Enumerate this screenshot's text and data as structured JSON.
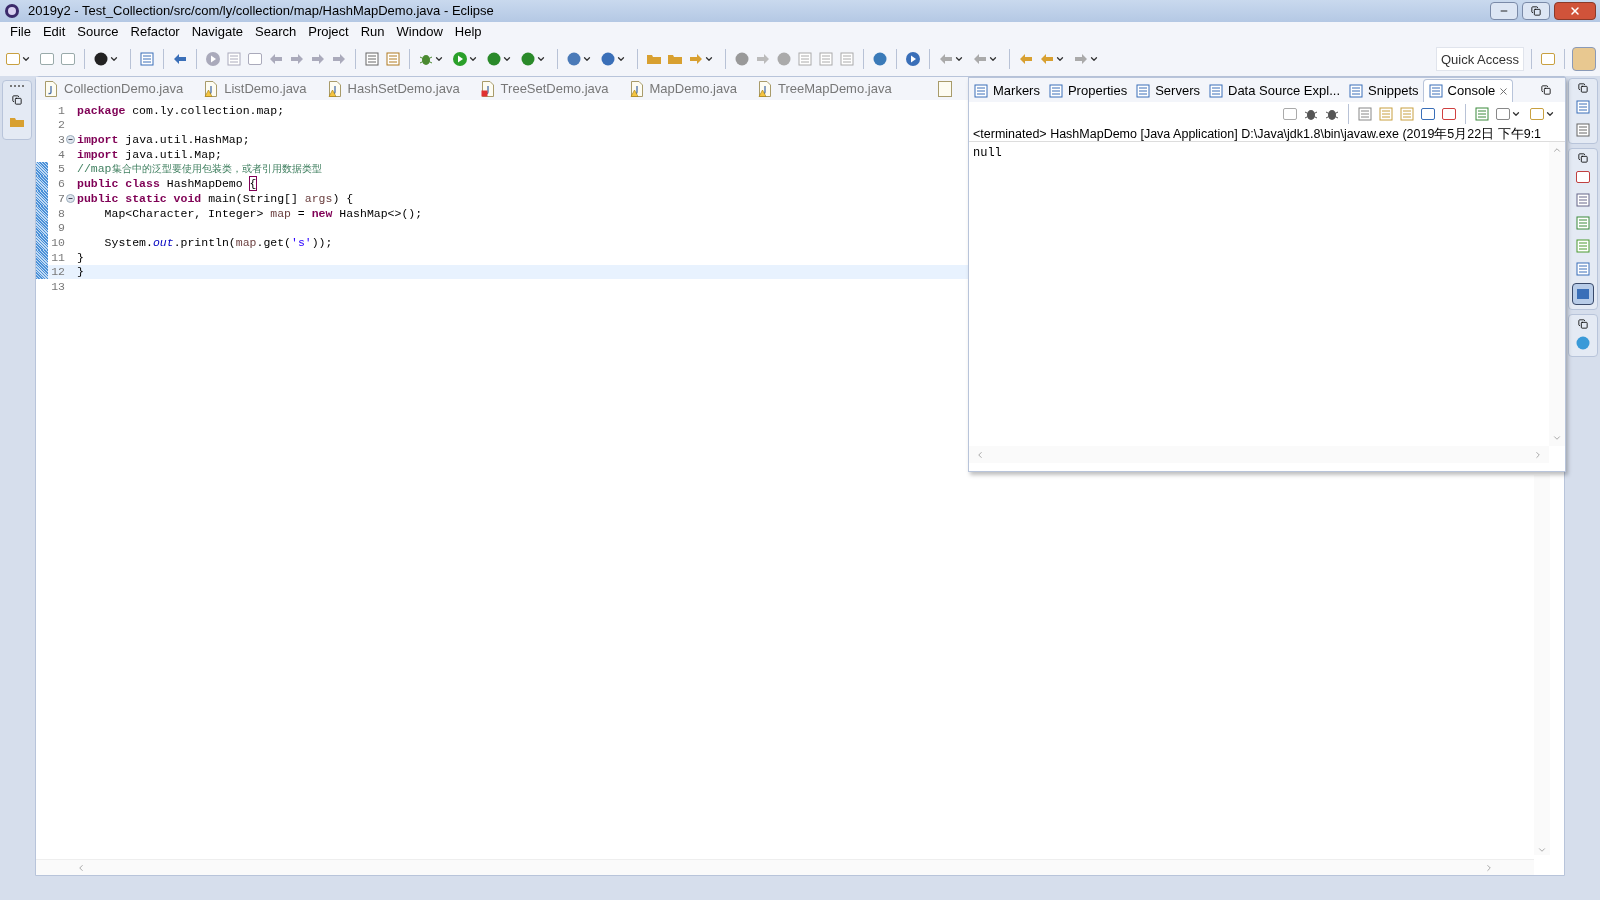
{
  "window": {
    "title": "2019y2 - Test_Collection/src/com/ly/collection/map/HashMapDemo.java - Eclipse"
  },
  "menu": [
    "File",
    "Edit",
    "Source",
    "Refactor",
    "Navigate",
    "Search",
    "Project",
    "Run",
    "Window",
    "Help"
  ],
  "toolbar": {
    "quick_access": {
      "placeholder": "Quick Access"
    }
  },
  "editor": {
    "tabs": [
      {
        "label": "CollectionDemo.java",
        "selected": false,
        "warning": false,
        "error": false
      },
      {
        "label": "ListDemo.java",
        "selected": false,
        "warning": true,
        "error": false
      },
      {
        "label": "HashSetDemo.java",
        "selected": false,
        "warning": true,
        "error": false
      },
      {
        "label": "TreeSetDemo.java",
        "selected": false,
        "warning": false,
        "error": true
      },
      {
        "label": "MapDemo.java",
        "selected": false,
        "warning": true,
        "error": false
      },
      {
        "label": "TreeMapDemo.java",
        "selected": false,
        "warning": true,
        "error": false
      }
    ],
    "lines": [
      {
        "number": "1",
        "fold": false,
        "changed": false,
        "current": false,
        "tokens": [
          {
            "kind": "keyword",
            "text": "package"
          },
          {
            "kind": "plain",
            "text": " com.ly.collection.map;"
          }
        ]
      },
      {
        "number": "2",
        "fold": false,
        "changed": false,
        "current": false
      },
      {
        "number": "3",
        "fold": true,
        "changed": false,
        "current": false,
        "tokens": [
          {
            "kind": "keyword",
            "text": "import"
          },
          {
            "kind": "plain",
            "text": " java.util.HashMap;"
          }
        ]
      },
      {
        "number": "4",
        "fold": false,
        "changed": false,
        "current": false,
        "tokens": [
          {
            "kind": "keyword",
            "text": "import"
          },
          {
            "kind": "plain",
            "text": " java.util.Map;"
          }
        ]
      },
      {
        "number": "5",
        "fold": false,
        "changed": true,
        "current": false,
        "tokens": [
          {
            "kind": "comment",
            "text": "//map"
          },
          {
            "kind": "comment_cjk",
            "text": "集合中的泛型要使用包装类，或者引用数据类型"
          }
        ]
      },
      {
        "number": "6",
        "fold": false,
        "changed": true,
        "current": false,
        "tokens": [
          {
            "kind": "keyword",
            "text": "public class"
          },
          {
            "kind": "plain",
            "text": " HashMapDemo "
          },
          {
            "kind": "bracket_match",
            "text": "{"
          }
        ]
      },
      {
        "number": "7",
        "fold": true,
        "changed": true,
        "current": false,
        "tokens": [
          {
            "kind": "keyword",
            "text": "public static void"
          },
          {
            "kind": "plain",
            "text": " main(String[] "
          },
          {
            "kind": "local",
            "text": "args"
          },
          {
            "kind": "plain",
            "text": ") {"
          }
        ]
      },
      {
        "number": "8",
        "fold": false,
        "changed": true,
        "current": false,
        "tokens": [
          {
            "kind": "plain",
            "text": "    Map<Character, Integer> "
          },
          {
            "kind": "local",
            "text": "map"
          },
          {
            "kind": "plain",
            "text": " = "
          },
          {
            "kind": "keyword",
            "text": "new"
          },
          {
            "kind": "plain",
            "text": " HashMap<>();"
          }
        ]
      },
      {
        "number": "9",
        "fold": false,
        "changed": true,
        "current": false
      },
      {
        "number": "10",
        "fold": false,
        "changed": true,
        "current": false,
        "tokens": [
          {
            "kind": "plain",
            "text": "    System."
          },
          {
            "kind": "field",
            "text": "out"
          },
          {
            "kind": "plain",
            "text": ".println("
          },
          {
            "kind": "local",
            "text": "map"
          },
          {
            "kind": "plain",
            "text": ".get("
          },
          {
            "kind": "string",
            "text": "'s'"
          },
          {
            "kind": "plain",
            "text": "));"
          }
        ]
      },
      {
        "number": "11",
        "fold": false,
        "changed": true,
        "current": false,
        "tokens": [
          {
            "kind": "plain",
            "text": "}"
          }
        ]
      },
      {
        "number": "12",
        "fold": false,
        "changed": true,
        "current": true,
        "tokens": [
          {
            "kind": "plain",
            "text": "}"
          }
        ]
      },
      {
        "number": "13",
        "fold": false,
        "changed": false,
        "current": false
      }
    ]
  },
  "console": {
    "tabs": [
      {
        "label": "Markers",
        "selected": false,
        "closable": false
      },
      {
        "label": "Properties",
        "selected": false,
        "closable": false
      },
      {
        "label": "Servers",
        "selected": false,
        "closable": false
      },
      {
        "label": "Data Source Expl...",
        "selected": false,
        "closable": false
      },
      {
        "label": "Snippets",
        "selected": false,
        "closable": false
      },
      {
        "label": "Console",
        "selected": true,
        "closable": true
      }
    ],
    "header": "<terminated> HashMapDemo [Java Application] D:\\Java\\jdk1.8\\bin\\javaw.exe (2019年5月22日 下午9:1",
    "output": [
      "null"
    ]
  }
}
